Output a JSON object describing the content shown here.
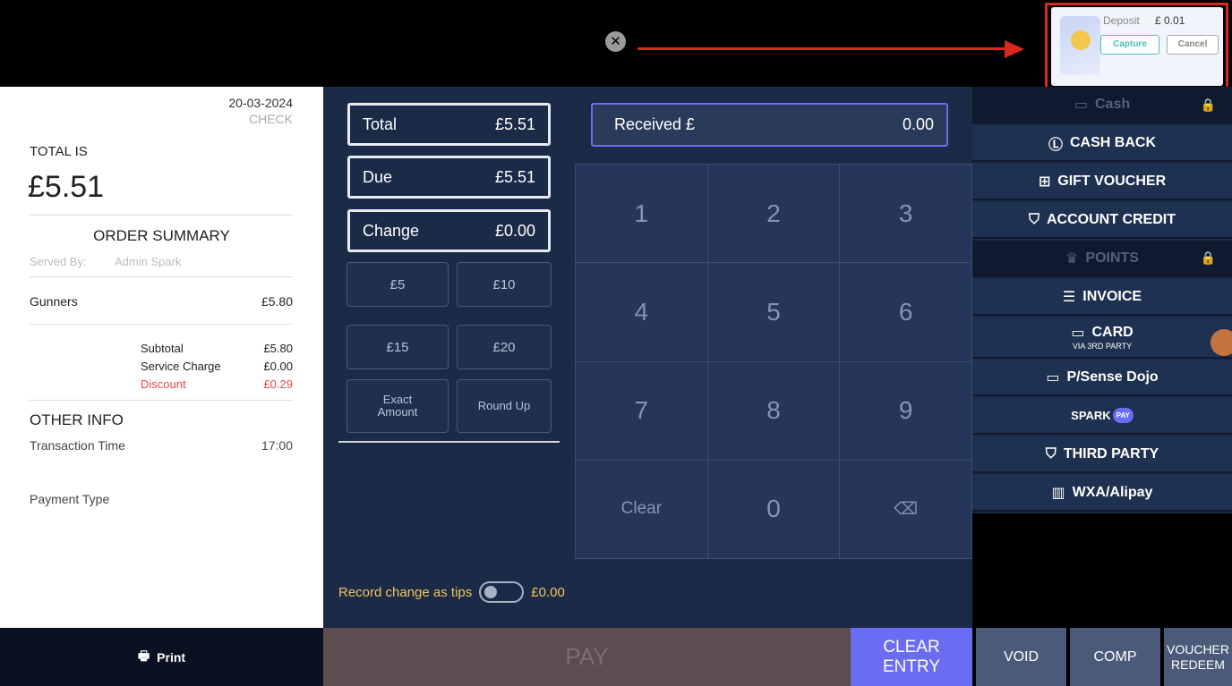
{
  "deposit_popup": {
    "label": "Deposit",
    "amount": "£ 0.01",
    "capture_label": "Capture",
    "cancel_label": "Cancel"
  },
  "receipt": {
    "date": "20-03-2024",
    "status": "CHECK",
    "total_label": "TOTAL IS",
    "total_value": "£5.51",
    "order_summary_title": "ORDER SUMMARY",
    "served_by_label": "Served By:",
    "served_by_value": "Admin Spark",
    "item_name": "Gunners",
    "item_price": "£5.80",
    "subtotal_label": "Subtotal",
    "subtotal_value": "£5.80",
    "service_label": "Service Charge",
    "service_value": "£0.00",
    "discount_label": "Discount",
    "discount_value": "£0.29",
    "other_info_title": "OTHER INFO",
    "transaction_time_label": "Transaction Time",
    "transaction_time_value": "17:00",
    "payment_type_label": "Payment Type"
  },
  "print_label": "Print",
  "summary": {
    "total_label": "Total",
    "total_value": "£5.51",
    "due_label": "Due",
    "due_value": "£5.51",
    "change_label": "Change",
    "change_value": "£0.00"
  },
  "quick_amounts": [
    "£5",
    "£10",
    "£15",
    "£20"
  ],
  "exact_amount_label": "Exact Amount",
  "round_up_label": "Round Up",
  "received": {
    "label": "Received £",
    "value": "0.00"
  },
  "keypad": [
    "1",
    "2",
    "3",
    "4",
    "5",
    "6",
    "7",
    "8",
    "9",
    "Clear",
    "0",
    "⌫"
  ],
  "tips": {
    "label": "Record change as tips",
    "value": "£0.00"
  },
  "actions": {
    "pay": "PAY",
    "clear_entry": "CLEAR ENTRY",
    "void": "VOID",
    "comp": "COMP",
    "voucher_redeem": "VOUCHER REDEEM"
  },
  "payment_methods": {
    "cash": "Cash",
    "cash_back": "CASH BACK",
    "gift_voucher": "GIFT VOUCHER",
    "account_credit": "ACCOUNT CREDIT",
    "points": "POINTS",
    "invoice": "INVOICE",
    "card": "CARD",
    "card_sub": "VIA 3RD PARTY",
    "psense_dojo": "P/Sense Dojo",
    "spark_pay": "SPARK",
    "spark_pay_badge": "PAY",
    "third_party": "THIRD PARTY",
    "wxa_alipay": "WXA/Alipay"
  },
  "colors": {
    "accent": "#6a6cf2",
    "panel": "#1b2a47",
    "discount": "#e0484c",
    "tips": "#f0c45a",
    "highlight": "#d9281e"
  }
}
